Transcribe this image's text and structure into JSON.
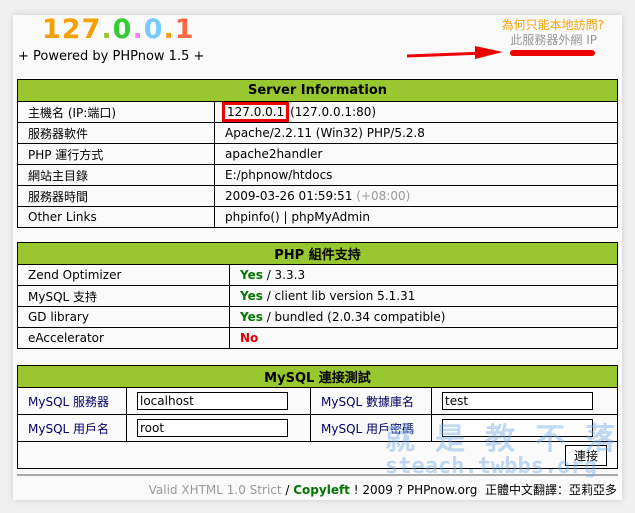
{
  "header": {
    "logo_parts": [
      "127",
      ".",
      "0",
      ".",
      "0",
      ".",
      "1"
    ],
    "logo_colors": [
      "#f5a000",
      "#99c730",
      "#33cc33",
      "#ee88ee",
      "#77ccff",
      "#f5a000",
      "#ff6644"
    ],
    "powered": "+ Powered by PHPnow 1.5 +",
    "why_link": "為何只能本地訪問?",
    "external_ip_label": "此服務器外網 IP"
  },
  "server": {
    "title": "Server Information",
    "rows": [
      {
        "label": "主機名 (IP:端口)",
        "value": "127.0.0.1",
        "extra": "(127.0.0.1:80)"
      },
      {
        "label": "服務器軟件",
        "value": "Apache/2.2.11 (Win32) PHP/5.2.8"
      },
      {
        "label": "PHP 運行方式",
        "value": "apache2handler"
      },
      {
        "label": "網站主目錄",
        "value": "E:/phpnow/htdocs"
      },
      {
        "label": "服務器時間",
        "value": "2009-03-26 01:59:51",
        "extra": "(+08:00)"
      },
      {
        "label": "Other Links",
        "links": [
          "phpinfo()",
          "phpMyAdmin"
        ],
        "sep": " | "
      }
    ]
  },
  "php": {
    "title": "PHP 組件支持",
    "rows": [
      {
        "label": "Zend Optimizer",
        "status": "Yes",
        "detail": " / 3.3.3"
      },
      {
        "label": "MySQL 支持",
        "status": "Yes",
        "detail": " / client lib version 5.1.31"
      },
      {
        "label": "GD library",
        "status": "Yes",
        "detail": " / bundled (2.0.34 compatible)"
      },
      {
        "label": "eAccelerator",
        "status": "No",
        "detail": ""
      }
    ]
  },
  "mysql": {
    "title": "MySQL 連接測試",
    "server_label": "MySQL 服務器",
    "server_value": "localhost",
    "db_label": "MySQL 數據庫名",
    "db_value": "test",
    "user_label": "MySQL 用戶名",
    "user_value": "root",
    "pass_label": "MySQL 用戶密碼",
    "pass_value": "",
    "connect": "連接"
  },
  "footer": {
    "valid": "Valid XHTML 1.0 Strict",
    "slash": " / ",
    "copyleft": "Copyleft",
    "rest": " ! 2009 ? PHPnow.org",
    "translation": "正體中文翻譯：亞莉亞多"
  },
  "watermark": {
    "line1": "就是教不落",
    "line2": "steach.twbbs.org"
  }
}
